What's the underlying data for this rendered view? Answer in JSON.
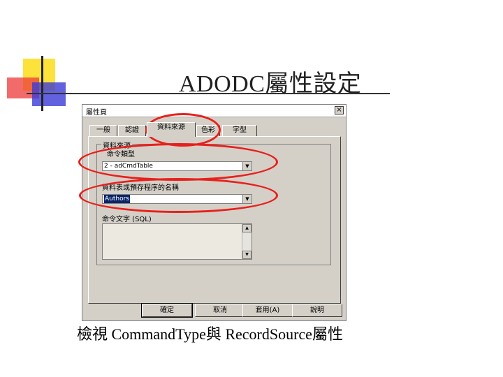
{
  "slide": {
    "title": "ADODC屬性設定",
    "caption": "檢視 CommandType與 RecordSource屬性"
  },
  "dialog": {
    "title": "屬性頁",
    "close_label": "×",
    "tabs": [
      {
        "label": "一般"
      },
      {
        "label": "認證"
      },
      {
        "label": "資料來源",
        "active": true
      },
      {
        "label": "色彩"
      },
      {
        "label": "字型"
      }
    ],
    "group_label": "資料來源",
    "command_type_label": "命令類型",
    "command_type_value": "2 - adCmdTable",
    "record_source_label": "資料表或預存程序的名稱",
    "record_source_value": "Authors",
    "command_text_label": "命令文字 (SQL)",
    "command_text_value": "",
    "buttons": {
      "ok": "確定",
      "cancel": "取消",
      "apply": "套用(A)",
      "help": "說明"
    }
  },
  "colors": {
    "highlight_ellipse": "#e8201c",
    "deco_yellow": "#fde23b",
    "deco_red": "#ee3a3a",
    "deco_blue": "#3b3bd6"
  }
}
